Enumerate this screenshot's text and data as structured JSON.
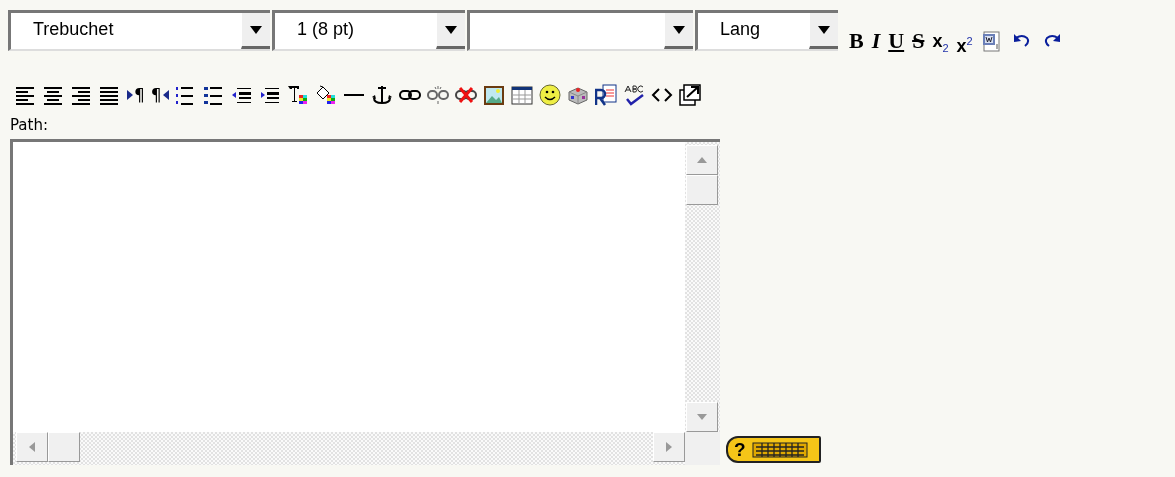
{
  "selects": [
    {
      "kind": "select",
      "value": "Trebuchet"
    },
    {
      "kind": "select",
      "value": "1 (8 pt)"
    },
    {
      "kind": "select"
    },
    {
      "kind": "select",
      "value": "Lang"
    }
  ],
  "style_buttons": [
    {
      "kind": "glyph",
      "label": "B"
    },
    {
      "kind": "glyph",
      "label": "I"
    },
    {
      "kind": "glyph",
      "label": "U"
    },
    {
      "kind": "glyph",
      "label": "S"
    },
    {
      "kind": "glyph",
      "label": "x$_{2}$"
    },
    {
      "kind": "glyph",
      "label": "x$^{2}$"
    },
    {
      "kind": "icon"
    },
    {
      "kind": "icon"
    },
    {
      "kind": "icon"
    }
  ],
  "format_buttons": [
    {
      "kind": "icon"
    },
    {
      "kind": "icon"
    },
    {
      "kind": "icon"
    },
    {
      "kind": "icon"
    },
    {
      "kind": "ltr",
      "label": "¶"
    },
    {
      "kind": "rtl",
      "label": "¶"
    },
    {
      "kind": "icon"
    },
    {
      "kind": "icon"
    },
    {
      "kind": "icon"
    },
    {
      "kind": "icon"
    },
    {
      "kind": "icon"
    },
    {
      "kind": "icon"
    },
    {
      "kind": "icon"
    },
    {
      "kind": "icon"
    },
    {
      "kind": "icon"
    },
    {
      "kind": "icon"
    },
    {
      "kind": "icon"
    },
    {
      "kind": "icon"
    },
    {
      "kind": "icon"
    },
    {
      "kind": "icon"
    },
    {
      "kind": "icon"
    },
    {
      "kind": "icon"
    },
    {
      "kind": "icon"
    },
    {
      "kind": "icon"
    },
    {
      "kind": "icon"
    }
  ],
  "path_label": "Path:",
  "help_button": {
    "label": "?"
  }
}
